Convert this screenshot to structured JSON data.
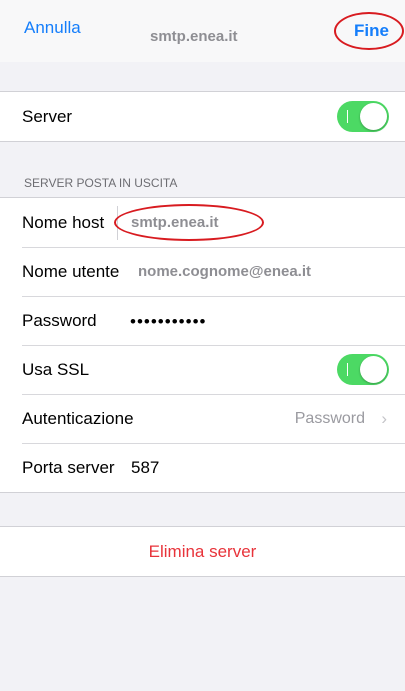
{
  "navbar": {
    "cancel_label": "Annulla",
    "title": "smtp.enea.it",
    "done_label": "Fine"
  },
  "server_row": {
    "label": "Server",
    "toggle_on": true
  },
  "section": {
    "header": "SERVER POSTA IN USCITA"
  },
  "fields": {
    "host": {
      "label": "Nome host",
      "value": "smtp.enea.it"
    },
    "username": {
      "label": "Nome utente",
      "value": "nome.cognome@enea.it"
    },
    "password": {
      "label": "Password",
      "value": "•••••••••••"
    },
    "ssl": {
      "label": "Usa SSL",
      "toggle_on": true
    },
    "auth": {
      "label": "Autenticazione",
      "value": "Password"
    },
    "port": {
      "label": "Porta server",
      "value": "587"
    }
  },
  "delete_label": "Elimina server",
  "colors": {
    "accent": "#157efb",
    "toggle_on": "#4cd964",
    "destructive": "#e8333a",
    "annotation": "#d81b20"
  }
}
